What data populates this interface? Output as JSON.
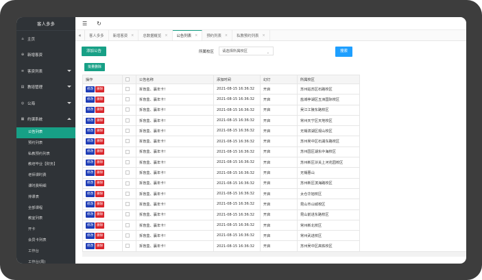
{
  "app": {
    "brand": "客人多多"
  },
  "topbar": {
    "menu_icon": "menu-icon",
    "refresh_icon": "refresh-icon"
  },
  "sidebar": {
    "items": [
      {
        "label": "主页",
        "icon": "home-icon",
        "has_caret": false
      },
      {
        "label": "新增客资",
        "icon": "user-plus-icon",
        "has_caret": false
      },
      {
        "label": "客资列表",
        "icon": "list-icon",
        "has_caret": true
      },
      {
        "label": "教培管理",
        "icon": "book-icon",
        "has_caret": true
      },
      {
        "label": "公海",
        "icon": "globe-icon",
        "has_caret": true
      },
      {
        "label": "约课系统",
        "icon": "calendar-icon",
        "has_caret": true,
        "open": true
      }
    ],
    "sub_items": [
      {
        "label": "公告列表",
        "active": true
      },
      {
        "label": "预约列表"
      },
      {
        "label": "私教预约列表"
      },
      {
        "label": "教培毕业【财务】"
      },
      {
        "label": "老师课时费"
      },
      {
        "label": "课时费明细"
      },
      {
        "label": "排课表"
      },
      {
        "label": "全部课程"
      },
      {
        "label": "教室列表"
      },
      {
        "label": "开卡"
      },
      {
        "label": "会员卡列表"
      },
      {
        "label": "工作台"
      },
      {
        "label": "工作台(周)"
      }
    ]
  },
  "tabs": {
    "prev_icon": "double-chevron-left-icon",
    "items": [
      {
        "label": "客人多多",
        "closable": false
      },
      {
        "label": "新增客资",
        "closable": true
      },
      {
        "label": "总数据概览",
        "closable": true
      },
      {
        "label": "公告列表",
        "closable": true,
        "active": true
      },
      {
        "label": "预约列表",
        "closable": true
      },
      {
        "label": "私教预约列表",
        "closable": true
      }
    ]
  },
  "toolbar": {
    "add_label": "添加公告",
    "filter_label": "所属校区",
    "select_placeholder": "请选择所属校区",
    "search_label": "搜索",
    "batch_delete_label": "批量删除"
  },
  "table": {
    "headers": [
      "操作",
      "",
      "公告名称",
      "添加时间",
      "幻灯",
      "所属校区"
    ],
    "edit_label": "修改",
    "delete_label": "删除",
    "rows": [
      {
        "title": "拆盲盒、赢年卡!",
        "time": "2021-08-15 16:36:32",
        "pub": "开启",
        "school": "苏州姑苏区石路校区"
      },
      {
        "title": "拆盲盒、赢年卡!",
        "time": "2021-08-15 16:36:32",
        "pub": "开启",
        "school": "盐城亭湖区五洲国际校区"
      },
      {
        "title": "拆盲盒、赢年卡!",
        "time": "2021-08-15 16:36:32",
        "pub": "开启",
        "school": "吴江江陵东路校区"
      },
      {
        "title": "拆盲盒、赢年卡!",
        "time": "2021-08-15 16:36:32",
        "pub": "开启",
        "school": "常州天宁区天地校区"
      },
      {
        "title": "拆盲盒、赢年卡!",
        "time": "2021-08-15 16:36:32",
        "pub": "开启",
        "school": "无锡滨湖区观山校区"
      },
      {
        "title": "拆盲盒、赢年卡!",
        "time": "2021-08-15 16:36:32",
        "pub": "开启",
        "school": "苏州吴中区石湖东路校区"
      },
      {
        "title": "拆盲盒、赢年卡!",
        "time": "2021-08-15 16:36:32",
        "pub": "开启",
        "school": "苏州园区湖东中海校区"
      },
      {
        "title": "拆盲盒、赢年卡!",
        "time": "2021-08-15 16:36:32",
        "pub": "开启",
        "school": "苏州新区浒关上河花园校区"
      },
      {
        "title": "拆盲盒、赢年卡!",
        "time": "2021-08-15 16:36:32",
        "pub": "开启",
        "school": "无锡惠山"
      },
      {
        "title": "拆盲盒、赢年卡!",
        "time": "2021-08-15 16:36:32",
        "pub": "开启",
        "school": "苏州新区滨海路校区"
      },
      {
        "title": "拆盲盒、赢年卡!",
        "time": "2021-08-15 16:36:32",
        "pub": "开启",
        "school": "太仓华旭校区"
      },
      {
        "title": "拆盲盒、赢年卡!",
        "time": "2021-08-15 16:36:32",
        "pub": "开启",
        "school": "昆山市山城校区"
      },
      {
        "title": "拆盲盒、赢年卡!",
        "time": "2021-08-15 16:36:32",
        "pub": "开启",
        "school": "昆山前进东路校区"
      },
      {
        "title": "拆盲盒、赢年卡!",
        "time": "2021-08-15 16:36:32",
        "pub": "开启",
        "school": "常州新北校区"
      },
      {
        "title": "拆盲盒、赢年卡!",
        "time": "2021-08-15 16:36:32",
        "pub": "开启",
        "school": "常州武进校区"
      },
      {
        "title": "拆盲盒、赢年卡!",
        "time": "2021-08-15 16:36:32",
        "pub": "开启",
        "school": "苏州吴中区高铁校区"
      }
    ]
  }
}
